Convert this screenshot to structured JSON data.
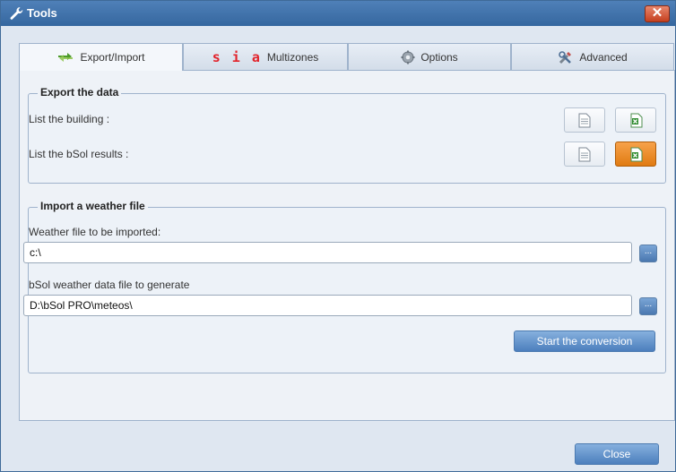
{
  "window": {
    "title": "Tools",
    "close_glyph": "✕"
  },
  "tabs": [
    {
      "label": "Export/Import",
      "icon": "arrows-exchange-icon",
      "active": true
    },
    {
      "label": "Multizones",
      "prefix": "s i a",
      "icon": "sia-logo"
    },
    {
      "label": "Options",
      "icon": "gear-icon"
    },
    {
      "label": "Advanced",
      "icon": "tools-icon"
    }
  ],
  "export": {
    "title": "Export the data",
    "building_label": "List the building :",
    "results_label": "List the bSol results :"
  },
  "import": {
    "title": "Import a weather file",
    "weather_label": "Weather file to be imported:",
    "weather_value": "c:\\",
    "bsol_label": "bSol weather data file to generate",
    "bsol_value": "D:\\bSol PRO\\meteos\\",
    "browse_glyph": "...",
    "start_button": "Start the conversion"
  },
  "footer": {
    "close_button": "Close"
  },
  "colors": {
    "accent_orange": "#e07b12",
    "title_blue": "#35679f",
    "excel_green": "#2e8b2e"
  }
}
